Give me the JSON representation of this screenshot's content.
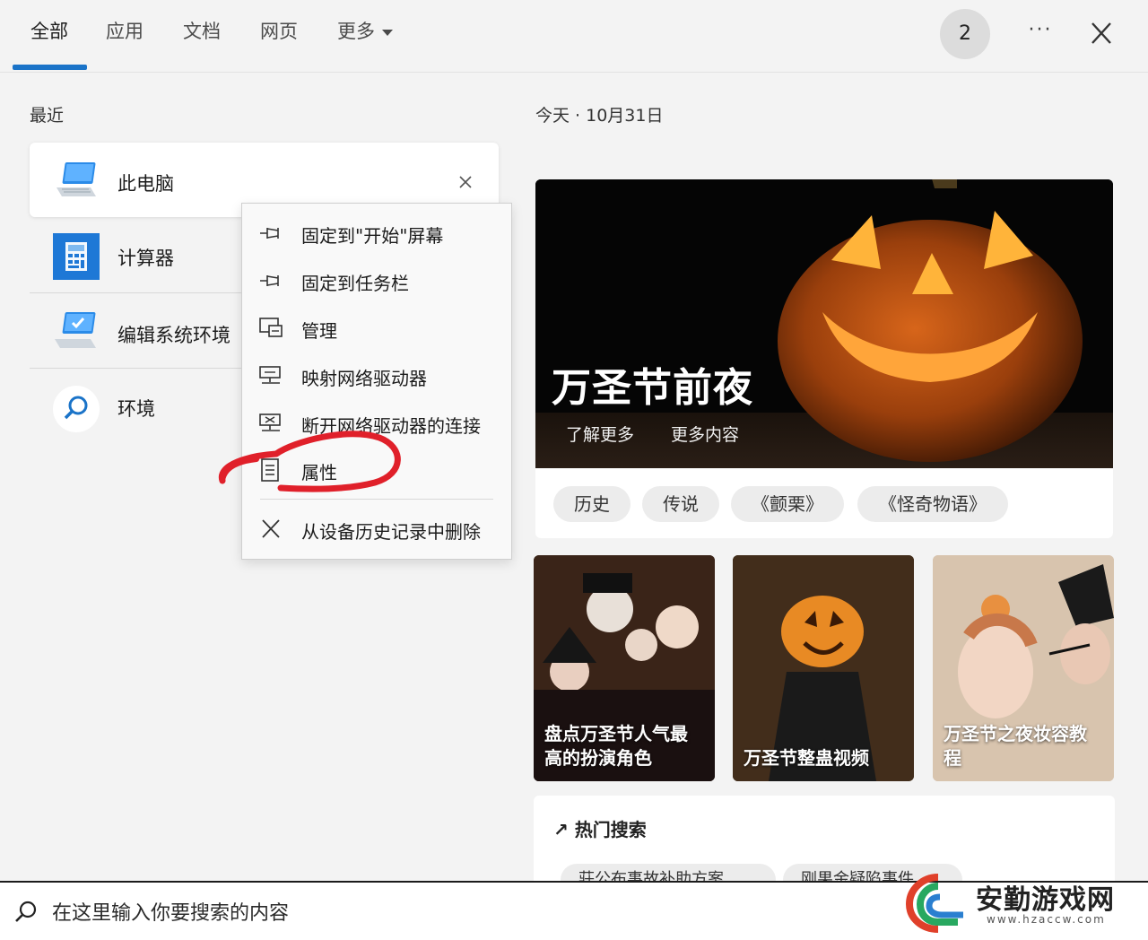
{
  "tabs": [
    {
      "label": "全部",
      "active": true
    },
    {
      "label": "应用"
    },
    {
      "label": "文档"
    },
    {
      "label": "网页"
    },
    {
      "label": "更多"
    }
  ],
  "header": {
    "badge_count": "2",
    "more_options": "···"
  },
  "recent": {
    "heading": "最近",
    "items": [
      {
        "label": "此电脑",
        "icon": "computer-icon"
      },
      {
        "label": "计算器",
        "icon": "calculator-icon"
      },
      {
        "label": "编辑系统环境",
        "icon": "system-settings-icon"
      },
      {
        "label": "环境",
        "icon": "search-icon"
      }
    ]
  },
  "context_menu": {
    "items": [
      {
        "label": "固定到\"开始\"屏幕",
        "icon": "pin-icon"
      },
      {
        "label": "固定到任务栏",
        "icon": "pin-icon"
      },
      {
        "label": "管理",
        "icon": "manage-icon"
      },
      {
        "label": "映射网络驱动器",
        "icon": "network-drive-icon"
      },
      {
        "label": "断开网络驱动器的连接",
        "icon": "disconnect-drive-icon"
      },
      {
        "label": "属性",
        "icon": "properties-icon"
      },
      {
        "label": "从设备历史记录中删除",
        "icon": "close-icon"
      }
    ]
  },
  "today": {
    "date_label": "今天 · 10月31日",
    "hero": {
      "title": "万圣节前夜",
      "links": [
        "了解更多",
        "更多内容"
      ]
    },
    "chips": [
      "历史",
      "传说",
      "《颤栗》",
      "《怪奇物语》"
    ],
    "thumbnails": [
      {
        "caption": "盘点万圣节人气最高的扮演角色"
      },
      {
        "caption": "万圣节整蛊视频"
      },
      {
        "caption": "万圣节之夜妆容教程"
      }
    ],
    "trending": {
      "title": "热门搜索",
      "items": [
        "莊公布事故补助方案",
        "刚果金疑陷事件"
      ]
    }
  },
  "search": {
    "placeholder": "在这里输入你要搜索的内容"
  },
  "watermark": {
    "text": "安勤游戏网",
    "url": "www.hzaccw.com"
  },
  "colors": {
    "accent": "#1a73c8",
    "annotation": "#e0202a"
  }
}
